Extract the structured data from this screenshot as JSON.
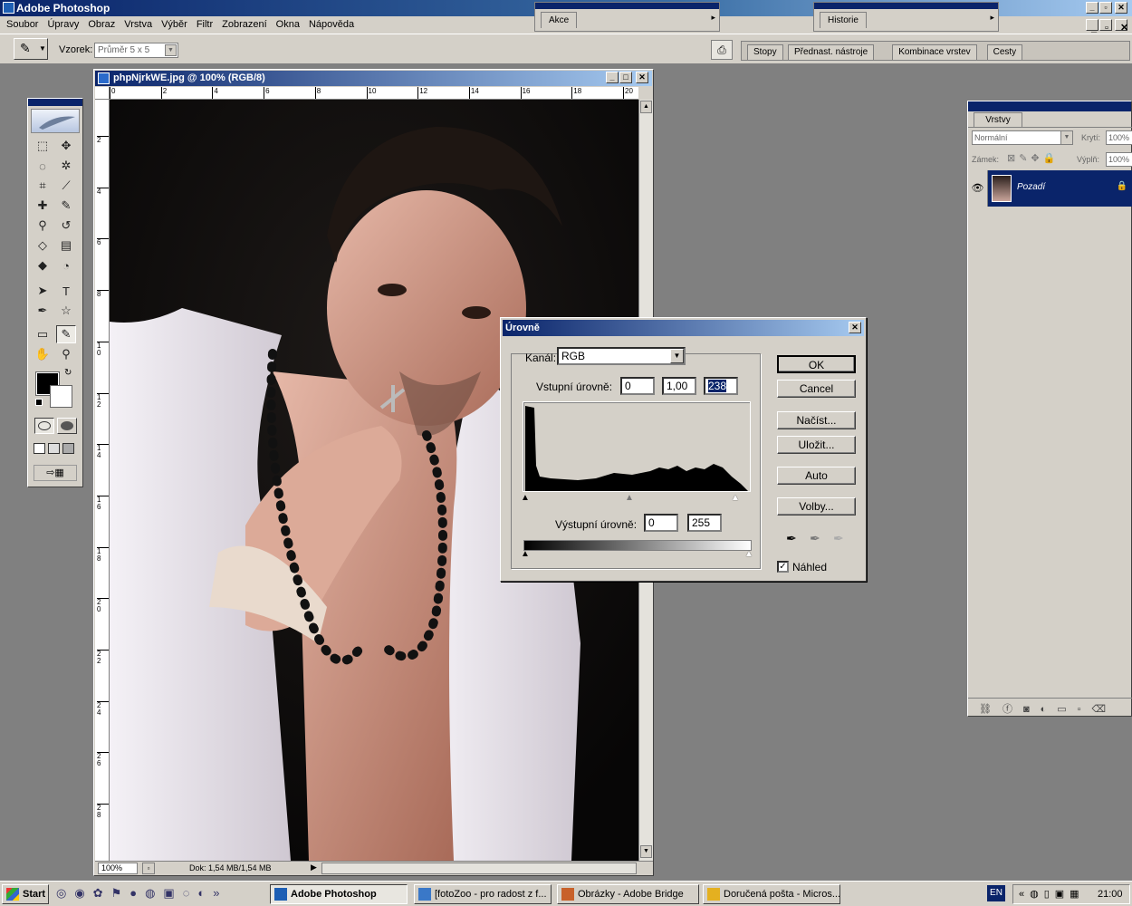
{
  "window": {
    "title": "Adobe Photoshop"
  },
  "menu": [
    "Soubor",
    "Úpravy",
    "Obraz",
    "Vrstva",
    "Výběr",
    "Filtr",
    "Zobrazení",
    "Okna",
    "Nápověda"
  ],
  "options": {
    "sample_label": "Vzorek:",
    "sample_value": "Průměr 5 x 5"
  },
  "mini_panels": {
    "actions": "Akce",
    "history": "Historie"
  },
  "palette_well": [
    "Stopy",
    "Přednast. nástroje",
    "Kombinace vrstev",
    "Cesty"
  ],
  "document": {
    "title": "phpNjrkWE.jpg @ 100% (RGB/8)",
    "zoom": "100%",
    "doc_size": "Dok: 1,54 MB/1,54 MB",
    "ruler_h": [
      "0",
      "2",
      "4",
      "6",
      "8",
      "10",
      "12",
      "14",
      "16",
      "18",
      "20"
    ],
    "ruler_v": [
      "2",
      "4",
      "6",
      "8",
      "1\n0",
      "1\n2",
      "1\n4",
      "1\n6",
      "1\n8",
      "2\n0",
      "2\n2",
      "2\n4",
      "2\n6",
      "2\n8"
    ]
  },
  "layers": {
    "tab": "Vrstvy",
    "blend_mode": "Normální",
    "opacity_label": "Krytí:",
    "opacity_value": "100%",
    "lock_label": "Zámek:",
    "fill_label": "Výplň:",
    "fill_value": "100%",
    "layer_name": "Pozadí"
  },
  "levels": {
    "title": "Úrovně",
    "channel_label": "Kanál:",
    "channel_value": "RGB",
    "input_label": "Vstupní úrovně:",
    "input_black": "0",
    "input_gamma": "1,00",
    "input_white": "238",
    "output_label": "Výstupní úrovně:",
    "output_black": "0",
    "output_white": "255",
    "buttons": {
      "ok": "OK",
      "cancel": "Cancel",
      "load": "Načíst...",
      "save": "Uložit...",
      "auto": "Auto",
      "options": "Volby..."
    },
    "preview_label": "Náhled",
    "preview_checked": true
  },
  "taskbar": {
    "start": "Start",
    "tasks": [
      "Adobe Photoshop",
      "[fotoZoo - pro radost z f...",
      "Obrázky - Adobe Bridge",
      "Doručená pošta - Micros..."
    ],
    "lang": "EN",
    "time": "21:00"
  }
}
